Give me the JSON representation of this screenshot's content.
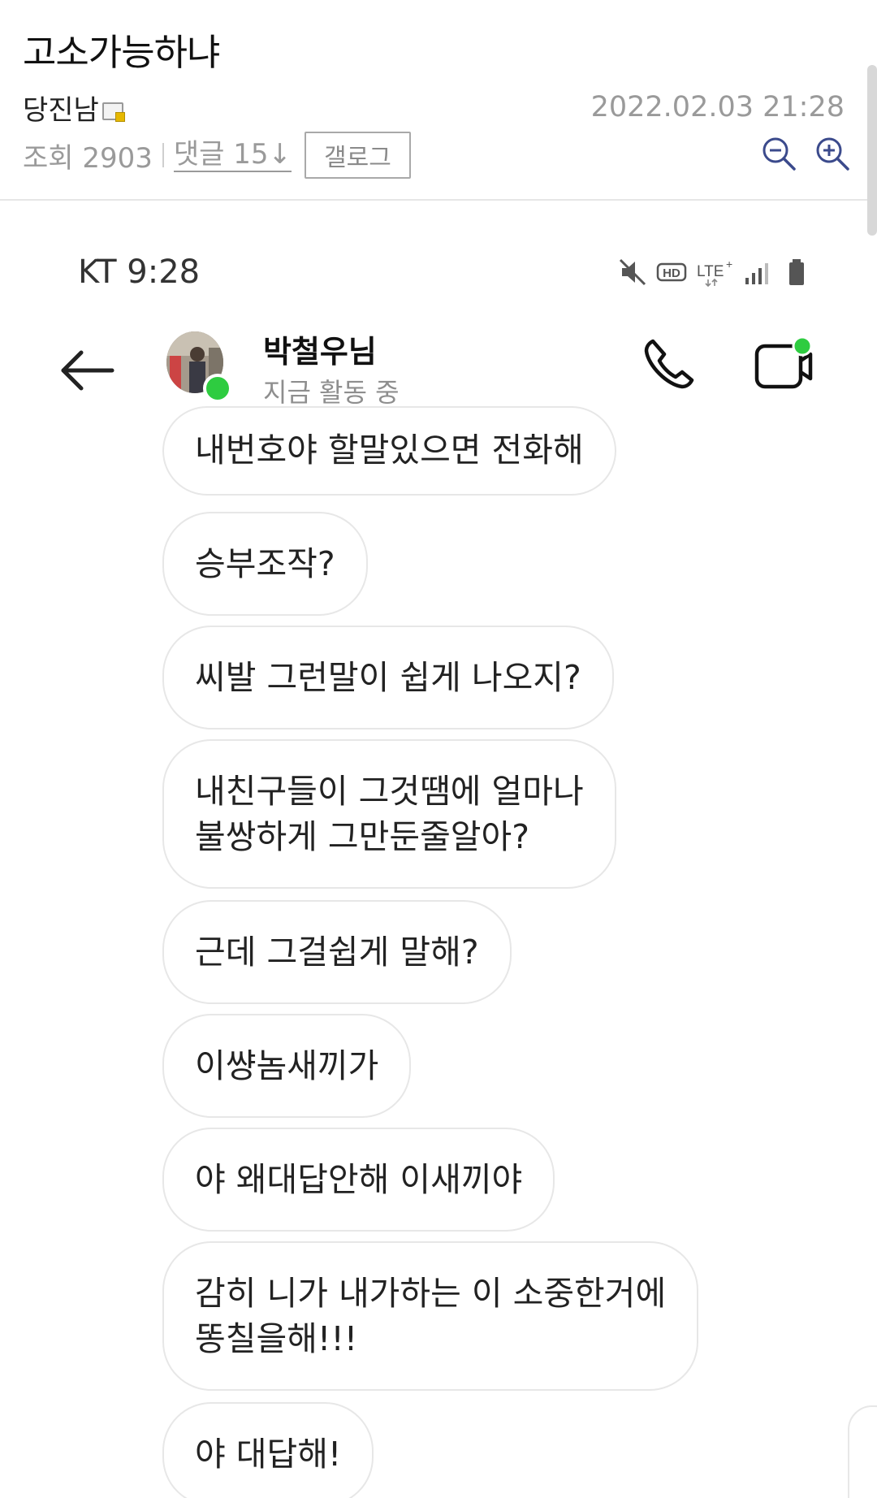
{
  "post": {
    "title": "고소가능하냐",
    "author": "당진남",
    "date": "2022.02.03 21:28",
    "views_label": "조회 2903",
    "comments_label": "댓글 15↓",
    "gallog_label": "갤로그"
  },
  "screenshot": {
    "status_bar": {
      "carrier_time": "KT 9:28",
      "icons": [
        "mute-icon",
        "hd-icon",
        "lte-plus-icon",
        "signal-icon",
        "battery-icon"
      ]
    },
    "chat_header": {
      "name": "박철우님",
      "status": "지금 활동 중",
      "online_color": "#2ecc40"
    },
    "messages": [
      {
        "text": "내번호야 할말있으면 전화해"
      },
      {
        "text": "승부조작?"
      },
      {
        "text": "씨발 그런말이 쉽게 나오지?"
      },
      {
        "line1": "내친구들이 그것땜에 얼마나",
        "line2": "불쌍하게 그만둔줄알아?"
      },
      {
        "text": "근데 그걸쉽게 말해?"
      },
      {
        "text": "이썅놈새끼가"
      },
      {
        "text": "야 왜대답안해 이새끼야"
      },
      {
        "line1": "감히 니가 내가하는 이 소중한거에",
        "line2": "똥칠을해!!!"
      },
      {
        "text": "야 대답해!"
      }
    ]
  }
}
